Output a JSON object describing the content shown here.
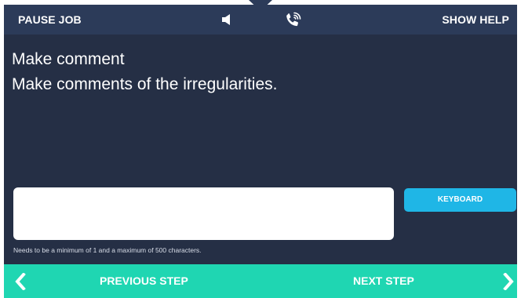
{
  "header": {
    "pause_label": "PAUSE JOB",
    "help_label": "SHOW HELP",
    "icons": [
      "speaker-icon",
      "phone-call-icon"
    ]
  },
  "step": {
    "title": "Make comment",
    "instruction": "Make comments of the irregularities."
  },
  "comment": {
    "value": "",
    "placeholder": "",
    "hint": "Needs to be a minimum of 1 and a maximum of 500 characters."
  },
  "keyboard": {
    "label": "KEYBOARD"
  },
  "footer": {
    "previous_label": "PREVIOUS STEP",
    "next_label": "NEXT STEP"
  },
  "colors": {
    "background": "#252f45",
    "header": "#2c3b59",
    "accent": "#1fb6e6",
    "footer": "#1fd6b2"
  }
}
